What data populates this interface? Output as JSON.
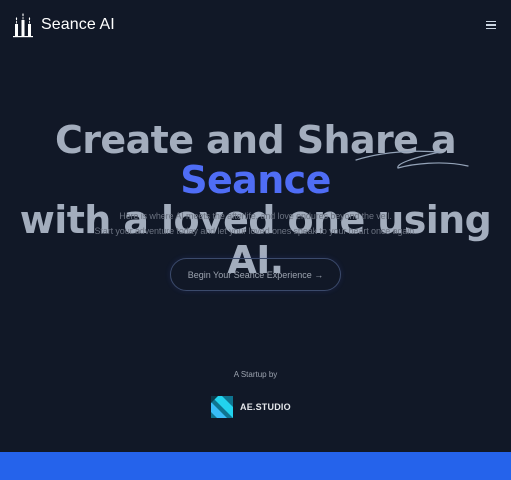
{
  "brand": {
    "name": "Seance AI",
    "logo_icon": "candles-icon"
  },
  "nav": {
    "menu_icon": "hamburger-menu-icon"
  },
  "hero": {
    "line1_prefix": "Create and Share a ",
    "line1_accent": "Seance",
    "line2": "with a loved one using AI.",
    "accent_color": "#4f6df5"
  },
  "subtitle": {
    "line1": "Here is where AI meets the afterlife, and love endures beyond the veil.",
    "line2": "Start your adventure today and let your loved ones speak to your heart once again."
  },
  "cta": {
    "label": "Begin Your Seance Experience →"
  },
  "startup": {
    "caption": "A Startup by",
    "company": "AE.STUDIO",
    "logo_icon": "ae-studio-logo-icon"
  },
  "colors": {
    "background": "#111827",
    "footer_band": "#2563eb"
  }
}
